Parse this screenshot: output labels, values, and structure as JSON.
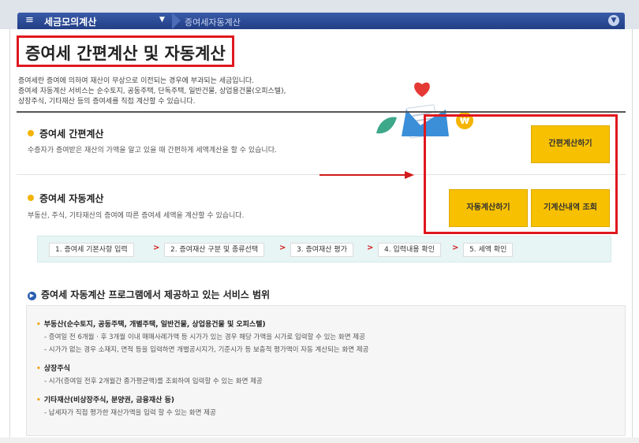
{
  "nav": {
    "menu_icon": "menu-icon",
    "title": "세금모의계산",
    "subtitle": "증여세자동계산"
  },
  "page": {
    "title": "증여세 간편계산 및 자동계산",
    "intro": [
      "증여세란 증여에 의하여 재산이 무상으로 이전되는 경우에 부과되는 세금입니다.",
      "증여세 자동계산 서비스는 순수토지, 공동주택, 단독주택, 일반건물, 상업용건물(오피스텔),",
      "상장주식, 기타재산 등의 증여세를 직접 계산할 수 있습니다."
    ]
  },
  "simple": {
    "title": "증여세 간편계산",
    "desc": "수증자가 증여받은 재산의 가액을 알고 있을 때 간편하게 세액계산을 할 수 있습니다.",
    "button": "간편계산하기"
  },
  "auto": {
    "title": "증여세 자동계산",
    "desc": "부동산, 주식, 기타재산의 증여에 따른 증여세 세액을 계산할 수 있습니다.",
    "button_calc": "자동계산하기",
    "button_history": "기계산내역 조회"
  },
  "steps": [
    "1. 증여세 기본사항 입력",
    "2. 증여재산 구분 및 종류선택",
    "3. 증여재산 평가",
    "4. 입력내용 확인",
    "5. 세액 확인"
  ],
  "scope": {
    "title": "증여세 자동계산 프로그램에서 제공하고 있는 서비스 범위",
    "items": [
      {
        "label": "부동산(순수토지, 공동주택, 개별주택, 일반건물, 상업용건물 및 오피스텔)",
        "subs": [
          "- 증여일 전 6개월 · 후 3개월 이내 매매사례가액 등 시가가 있는 경우 해당 가액을 시가로 입력할 수 있는 화면 제공",
          "- 시가가 없는 경우 소재지, 면적 등을 입력하면 개별공시지가, 기준시가 등 보충적 평가액이 자동 계산되는 화면 제공"
        ]
      },
      {
        "label": "상장주식",
        "subs": [
          "- 시가(증여일 전후 2개월간 종가평균액)를 조회하여 입력할 수 있는 화면 제공"
        ]
      },
      {
        "label": "기타재산(비상장주식, 분양권, 금융재산 등)",
        "subs": [
          "- 납세자가 직접 평가한 재산가액을 입력 할 수 있는 화면 제공"
        ]
      }
    ]
  },
  "colors": {
    "accent_red": "#e0181f",
    "button_yellow": "#f7c000",
    "nav_blue": "#2a4790"
  }
}
